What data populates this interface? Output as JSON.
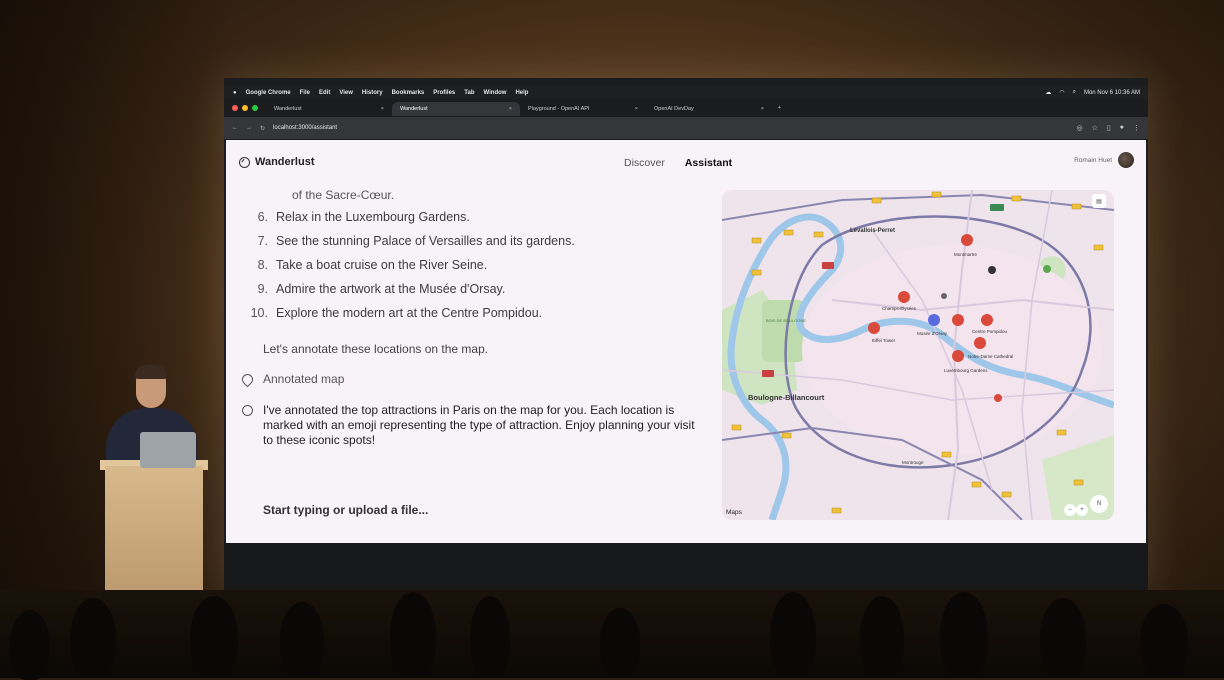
{
  "system_menu": {
    "app_name": "Google Chrome",
    "items": [
      "File",
      "Edit",
      "View",
      "History",
      "Bookmarks",
      "Profiles",
      "Tab",
      "Window",
      "Help"
    ],
    "clock": "Mon Nov 6 10:36 AM"
  },
  "tabs": [
    {
      "label": "Wanderlust",
      "active": false
    },
    {
      "label": "Wanderlust",
      "active": true
    },
    {
      "label": "Playground - OpenAI API",
      "active": false
    },
    {
      "label": "OpenAI DevDay",
      "active": false
    }
  ],
  "address": {
    "url": "localhost:3000/assistant"
  },
  "app": {
    "brand": "Wanderlust",
    "nav": {
      "discover": "Discover",
      "assistant": "Assistant"
    },
    "user_name": "Romain Huet"
  },
  "chat": {
    "partial_line": "of the Sacre-Cœur.",
    "list": [
      {
        "num": "6.",
        "text": "Relax in the Luxembourg Gardens."
      },
      {
        "num": "7.",
        "text": "See the stunning Palace of Versailles and its gardens."
      },
      {
        "num": "8.",
        "text": "Take a boat cruise on the River Seine."
      },
      {
        "num": "9.",
        "text": "Admire the artwork at the Musée d'Orsay."
      },
      {
        "num": "10.",
        "text": "Explore the modern art at the Centre Pompidou."
      }
    ],
    "followup": "Let's annotate these locations on the map.",
    "tool_call": "Annotated map",
    "assistant_message": "I've annotated the top attractions in Paris on the map for you. Each location is marked with an emoji representing the type of attraction. Enjoy planning your visit to these iconic spots!",
    "composer_placeholder": "Start typing or upload a file..."
  },
  "map": {
    "labels": {
      "levallois": "Levallois-Perret",
      "montmartre": "Montmartre",
      "champs": "Champs-Élysées",
      "eiffel": "Eiffel Tower",
      "orsay": "Musée d'Orsay",
      "pompidou": "Centre Pompidou",
      "notredame": "Notre-Dame Cathedral",
      "luxembourg": "Luxembourg Gardens",
      "boulogne": "Boulogne-Billancourt",
      "bois": "BOIS DE BOULOGNE",
      "montrouge": "Montrouge"
    },
    "attribution": "Maps",
    "compass": "N",
    "zoom_out": "−",
    "zoom_in": "+"
  }
}
